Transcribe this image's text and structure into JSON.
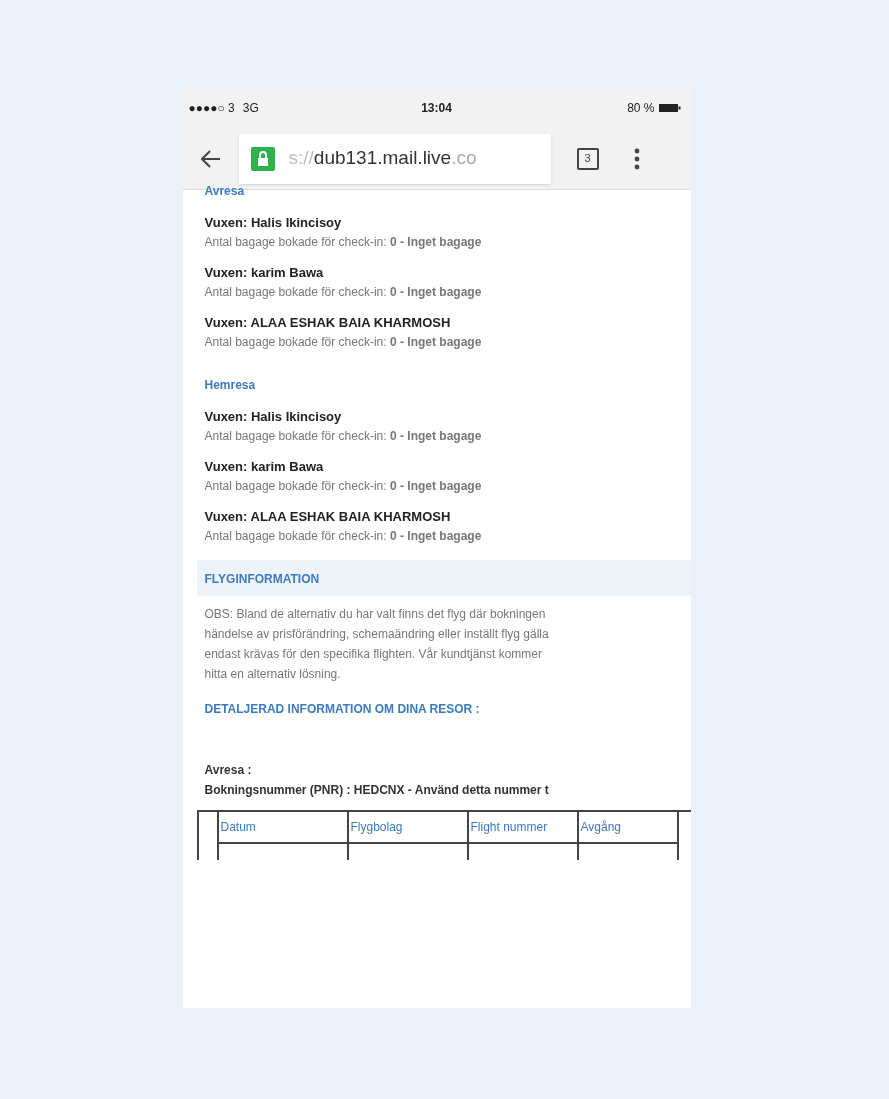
{
  "status_bar": {
    "carrier": "●●●●○ 3",
    "network": "3G",
    "time": "13:04",
    "battery": "80 %"
  },
  "browser": {
    "url_faded_start": "s://",
    "url_main": "dub131.mail.live",
    "url_faded_end": ".co",
    "tab_count": "3"
  },
  "sections": [
    {
      "title": "Avresa",
      "passengers": [
        {
          "name": "Vuxen: Halis Ikincisoy",
          "baggage": "Antal bagage bokade för check-in: **0 - Inget bagage**"
        },
        {
          "name": "Vuxen: karim Bawa",
          "baggage": "Antal bagage bokade för check-in: **0 - Inget bagage**"
        },
        {
          "name": "Vuxen: ALAA ESHAK BAIA KHARMOSH",
          "baggage": "Antal bagage bokade för check-in: **0 - Inget bagage**"
        }
      ]
    },
    {
      "title": "Hemresa",
      "passengers": [
        {
          "name": "Vuxen: Halis Ikincisoy",
          "baggage": "Antal bagage bokade för check-in: **0 - Inget bagage**"
        },
        {
          "name": "Vuxen: karim Bawa",
          "baggage": "Antal bagage bokade för check-in: **0 - Inget bagage**"
        },
        {
          "name": "Vuxen: ALAA ESHAK BAIA KHARMOSH",
          "baggage": "Antal bagage bokade för check-in: **0 - Inget bagage**"
        }
      ]
    }
  ],
  "flight_info": {
    "heading": "FLYGINFORMATION",
    "notice_lines": [
      "OBS: Bland de alternativ du har valt finns det flyg där bokningen",
      "händelse av prisförändring, schemaändring eller inställt flyg gälla",
      "endast krävas för den specifika flighten. Vår kundtjänst kommer",
      "hitta en alternativ lösning."
    ],
    "details_heading": "DETALJERAD INFORMATION OM DINA RESOR :",
    "trip_label": "Avresa :",
    "booking_number": "Bokningsnummer (PNR) : HEDCNX - Använd detta nummer t",
    "table": {
      "columns": [
        "Datum",
        "Flygbolag",
        "Flight nummer",
        "Avgång"
      ]
    }
  }
}
